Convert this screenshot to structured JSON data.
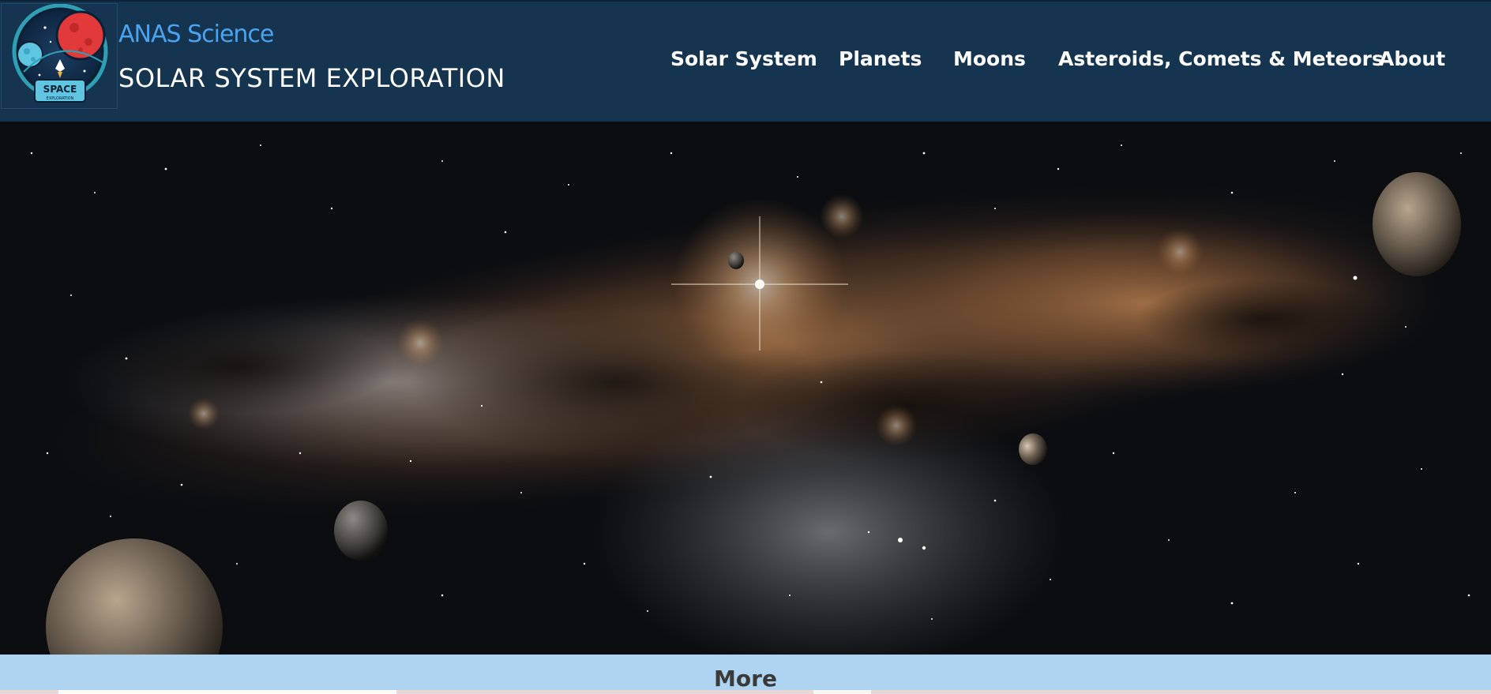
{
  "header": {
    "brand_top": "ANAS Science",
    "brand_bottom": "SOLAR SYSTEM EXPLORATION",
    "logo": {
      "icon": "space-exploration-badge-icon",
      "badge_text": "SPACE",
      "badge_subtext": "EXPLORATION"
    },
    "colors": {
      "header_bg": "#15344f",
      "brand_accent": "#4aa3f0"
    }
  },
  "nav": {
    "items": [
      {
        "label": "Solar System"
      },
      {
        "label": "Planets"
      },
      {
        "label": "Moons"
      },
      {
        "label": "Asteroids, Comets & Meteors"
      },
      {
        "label": "About"
      }
    ]
  },
  "hero": {
    "image": "milky-way-galaxy-with-planets"
  },
  "more_section": {
    "label": "More",
    "bg_color": "#aed4f1"
  }
}
